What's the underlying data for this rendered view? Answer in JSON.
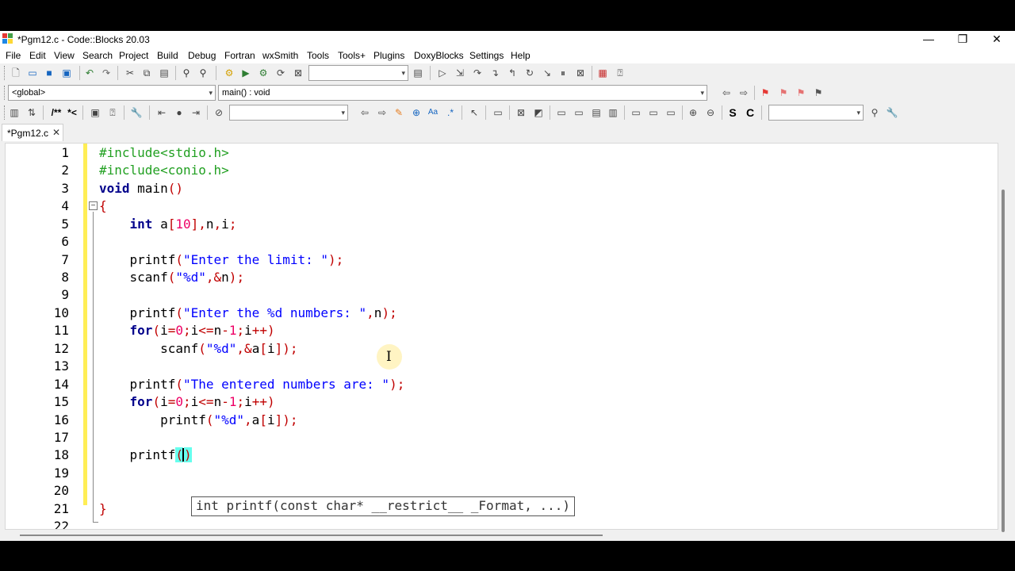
{
  "window": {
    "title": "*Pgm12.c - Code::Blocks 20.03",
    "minimize": "—",
    "restore": "❐",
    "close": "✕"
  },
  "menu": [
    "File",
    "Edit",
    "View",
    "Search",
    "Project",
    "Build",
    "Debug",
    "Fortran",
    "wxSmith",
    "Tools",
    "Tools+",
    "Plugins",
    "DoxyBlocks",
    "Settings",
    "Help"
  ],
  "scope": {
    "global": "<global>",
    "function": "main() : void"
  },
  "tab": {
    "label": "*Pgm12.c",
    "close": "✕"
  },
  "toolbar3": {
    "comment_block": "/**",
    "comment_line": "*<",
    "bold_s": "S",
    "bold_c": "C"
  },
  "code": {
    "line_numbers": [
      "1",
      "2",
      "3",
      "4",
      "5",
      "6",
      "7",
      "8",
      "9",
      "10",
      "11",
      "12",
      "13",
      "14",
      "15",
      "16",
      "17",
      "18",
      "19",
      "20",
      "21",
      "22"
    ],
    "lines": [
      "#include<stdio.h>",
      "#include<conio.h>",
      "void main()",
      "{",
      "    int a[10],n,i;",
      "",
      "    printf(\"Enter the limit: \");",
      "    scanf(\"%d\",&n);",
      "",
      "    printf(\"Enter the %d numbers: \",n);",
      "    for(i=0;i<=n-1;i++)",
      "        scanf(\"%d\",&a[i]);",
      "",
      "    printf(\"The entered numbers are: \");",
      "    for(i=0;i<=n-1;i++)",
      "        printf(\"%d\",a[i]);",
      "",
      "    printf()",
      "",
      "",
      "}",
      ""
    ]
  },
  "calltip": "int printf(const char* __restrict__ _Format, ...)",
  "colors": {
    "preprocessor": "#22a022",
    "keyword": "#00008b",
    "number": "#ee0066",
    "string": "#0000ff",
    "operator": "#c00000",
    "change_bar": "#ffee55"
  }
}
